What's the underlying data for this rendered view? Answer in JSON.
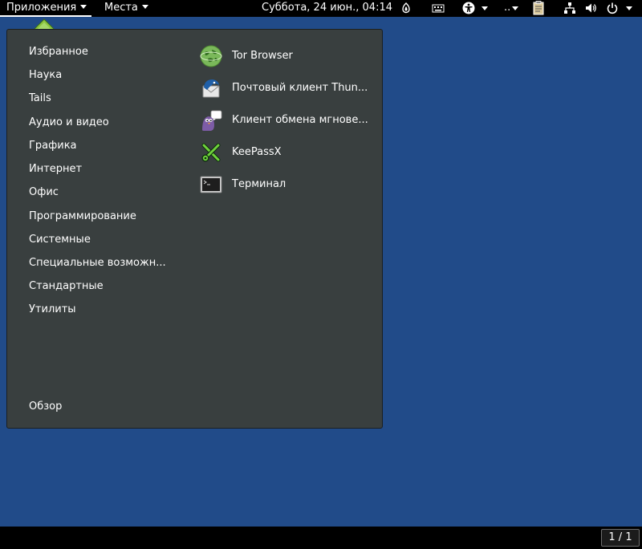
{
  "topbar": {
    "applications_label": "Приложения",
    "places_label": "Места",
    "clock": "Суббота, 24 июн., 04:14",
    "keyboard_label": ".."
  },
  "menu": {
    "categories": [
      "Избранное",
      "Наука",
      "Tails",
      "Аудио и видео",
      "Графика",
      "Интернет",
      "Офис",
      "Программирование",
      "Системные",
      "Специальные возможн...",
      "Стандартные",
      "Утилиты"
    ],
    "overview_label": "Обзор",
    "apps": [
      {
        "label": "Tor Browser",
        "icon": "tor-browser-icon"
      },
      {
        "label": "Почтовый клиент Thun...",
        "icon": "thunderbird-icon"
      },
      {
        "label": "Клиент обмена мгнове...",
        "icon": "pidgin-icon"
      },
      {
        "label": "KeePassX",
        "icon": "keepassx-icon"
      },
      {
        "label": "Терминал",
        "icon": "terminal-icon"
      }
    ]
  },
  "workspace_pager": "1 / 1",
  "colors": {
    "desktop": "#214b89",
    "menu_bg": "#393f3f",
    "bar": "#000000"
  }
}
